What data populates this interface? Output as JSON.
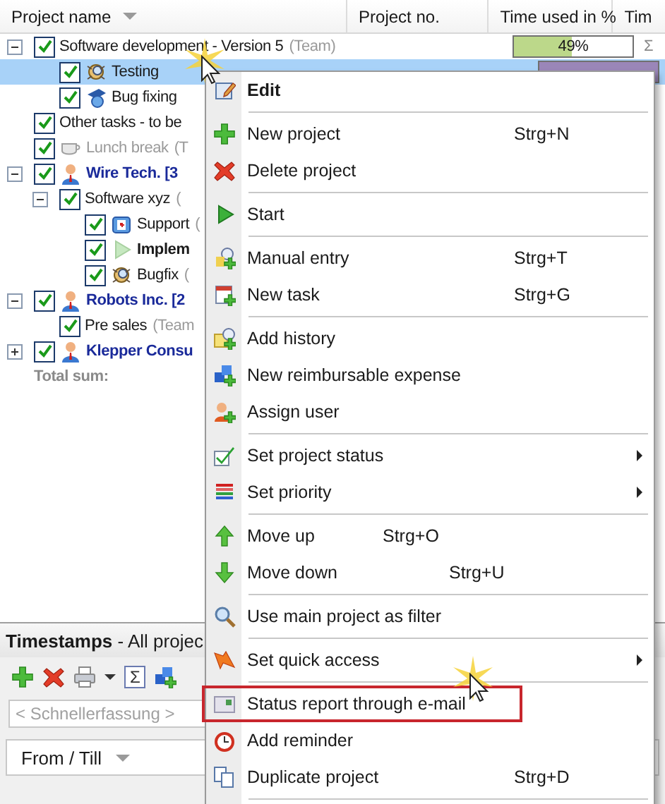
{
  "columns": [
    {
      "label": "Project name",
      "sort": true
    },
    {
      "label": "Project no.",
      "sort": false
    },
    {
      "label": "Time used in %",
      "sort": false
    },
    {
      "label": "Tim",
      "sort": false
    }
  ],
  "tree": [
    {
      "kind": "team",
      "name": "Software development  - Version 5",
      "note": "(Team)",
      "checked": true,
      "selected": false,
      "expanded": true,
      "time_used": {
        "text": "49%",
        "level": 0.49,
        "color": "#bcd88a"
      },
      "column_4": "Σ",
      "children": [
        {
          "kind": "testing",
          "name": "Testing",
          "checked": true,
          "selected": true,
          "time_used": {
            "level": 1,
            "color": "#9a86b8"
          }
        },
        {
          "kind": "bugfix",
          "name": "Bug fixing",
          "checked": true,
          "selected": false
        }
      ]
    },
    {
      "kind": "team",
      "name": "Other tasks - to be",
      "checked": true,
      "selected": false
    },
    {
      "kind": "break",
      "name": "Lunch break",
      "note": "(T",
      "checked": true,
      "selected": false
    },
    {
      "kind": "client",
      "name": "Wire Tech. [3",
      "checked": true,
      "selected": false,
      "expanded": true,
      "children": [
        {
          "kind": "team",
          "name": "Software xyz",
          "note": "(",
          "checked": true,
          "selected": false,
          "expanded": true,
          "children": [
            {
              "kind": "support",
              "name": "Support",
              "note": "(",
              "checked": true,
              "selected": false
            },
            {
              "kind": "running",
              "name": "Implem",
              "checked": true,
              "selected": false
            },
            {
              "kind": "testing",
              "name": "Bugfix",
              "note": "(",
              "checked": true,
              "selected": false
            }
          ]
        }
      ]
    },
    {
      "kind": "client",
      "name": "Robots Inc. [2",
      "checked": true,
      "selected": false,
      "expanded": true,
      "children": [
        {
          "kind": "team",
          "name": "Pre sales",
          "note": "(Team",
          "checked": true,
          "selected": false
        }
      ]
    },
    {
      "kind": "client",
      "name": "Klepper Consu",
      "checked": true,
      "selected": false,
      "expanded": false
    },
    {
      "kind": "total",
      "name": "Total sum:"
    }
  ],
  "timestamps": {
    "title": "**Timestamps** - All projec",
    "toolbar": [
      {
        "kind": "add"
      },
      {
        "kind": "delete"
      },
      {
        "kind": "print"
      },
      {
        "kind": "caret"
      },
      {
        "kind": "sum",
        "label": "Σ"
      },
      {
        "kind": "blocks"
      }
    ],
    "quick_entry": {
      "placeholder": "< Schnellerfassung >"
    },
    "columns": [
      {
        "label": "From / Till"
      }
    ]
  },
  "context_menu": [
    {
      "kind": "edit",
      "label": "Edit",
      "bold": true,
      "selected": false
    },
    {
      "kind": "separator"
    },
    {
      "kind": "new",
      "label": "New project",
      "shortcut": "Strg+N",
      "selected": false
    },
    {
      "kind": "delete",
      "label": "Delete project",
      "selected": false
    },
    {
      "kind": "separator"
    },
    {
      "kind": "start",
      "label": "Start",
      "selected": false
    },
    {
      "kind": "separator"
    },
    {
      "kind": "manual",
      "label": "Manual entry",
      "shortcut": "Strg+T",
      "selected": false
    },
    {
      "kind": "task",
      "label": "New task",
      "shortcut": "Strg+G",
      "selected": false
    },
    {
      "kind": "separator"
    },
    {
      "kind": "history",
      "label": "Add history",
      "selected": false
    },
    {
      "kind": "expense",
      "label": "New reimbursable expense",
      "selected": false
    },
    {
      "kind": "user",
      "label": "Assign user",
      "selected": false
    },
    {
      "kind": "separator"
    },
    {
      "kind": "status",
      "label": "Set project status",
      "submenu": true,
      "selected": false
    },
    {
      "kind": "priority",
      "label": "Set priority",
      "submenu": true,
      "selected": false
    },
    {
      "kind": "separator"
    },
    {
      "kind": "up",
      "label": "Move up",
      "shortcut": "Strg+O",
      "selected": false
    },
    {
      "kind": "down",
      "label": "Move down",
      "shortcut": "Strg+U",
      "selected": false
    },
    {
      "kind": "separator"
    },
    {
      "kind": "filter",
      "label": "Use main project as filter",
      "selected": false
    },
    {
      "kind": "separator"
    },
    {
      "kind": "quick",
      "label": "Set quick access",
      "submenu": true,
      "selected": false
    },
    {
      "kind": "separator"
    },
    {
      "kind": "report",
      "label": "Status report through e-mail",
      "selected": true
    },
    {
      "kind": "reminder",
      "label": "Add reminder",
      "selected": false
    },
    {
      "kind": "duplicate",
      "label": "Duplicate project",
      "shortcut": "Strg+D",
      "selected": false
    },
    {
      "kind": "separator"
    }
  ]
}
